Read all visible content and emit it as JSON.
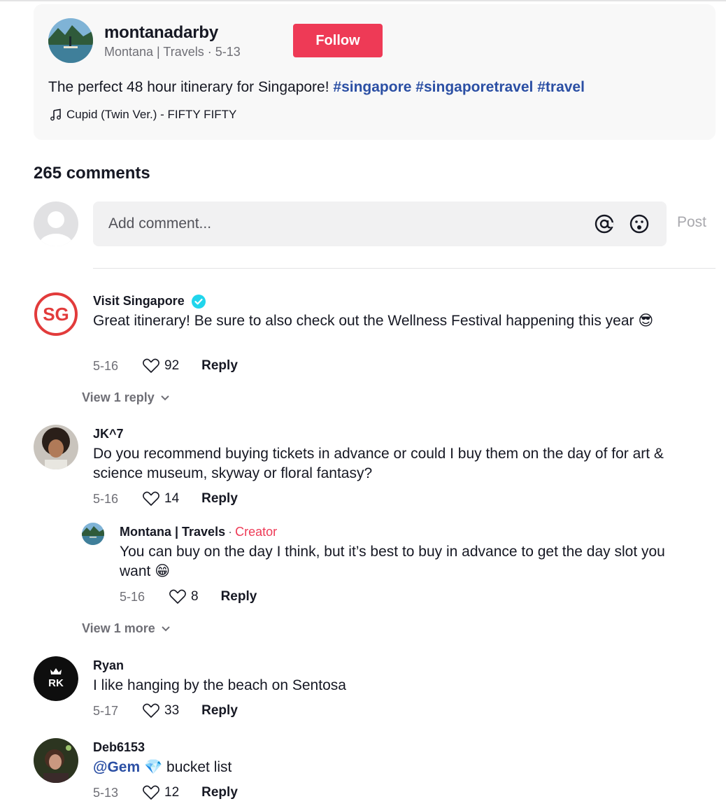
{
  "post": {
    "username": "montanadarby",
    "display_name": "Montana | Travels",
    "date": "5-13",
    "sub_separator": "·",
    "follow_label": "Follow",
    "caption_text": "The perfect 48 hour itinerary for Singapore!",
    "hashtags": [
      "#singapore",
      "#singaporetravel",
      "#travel"
    ],
    "music": "Cupid (Twin Ver.) - FIFTY FIFTY"
  },
  "comments_header": {
    "count_label": "265 comments"
  },
  "composer": {
    "placeholder": "Add comment...",
    "post_label": "Post"
  },
  "comments": [
    {
      "author": "Visit Singapore",
      "verified": true,
      "avatar_text": "SG",
      "text": "Great itinerary! Be sure to also check out the Wellness Festival happening this year",
      "emoji": "😎",
      "date": "5-16",
      "likes": "92",
      "reply_label": "Reply",
      "view_replies": "View 1 reply"
    },
    {
      "author": "JK^7",
      "text": "Do you recommend buying tickets in advance or could I buy them on the day of for art & science museum, skyway or floral fantasy?",
      "date": "5-16",
      "likes": "14",
      "reply_label": "Reply",
      "replies": [
        {
          "author": "Montana | Travels",
          "separator": "·",
          "badge": "Creator",
          "text": "You can buy on the day I think, but it’s best to buy in advance to get the day slot you want",
          "emoji": "😁",
          "date": "5-16",
          "likes": "8",
          "reply_label": "Reply"
        }
      ],
      "view_more": "View 1 more"
    },
    {
      "author": "Ryan",
      "avatar_text": "RK",
      "text": "I like hanging by the beach on Sentosa",
      "date": "5-17",
      "likes": "33",
      "reply_label": "Reply"
    },
    {
      "author": "Deb6153",
      "mention": "@Gem",
      "emoji": "💎",
      "text": "bucket list",
      "date": "5-13",
      "likes": "12",
      "reply_label": "Reply"
    }
  ],
  "colors": {
    "accent": "#ee3a56",
    "hashtag": "#2b4fa4",
    "muted": "#6f6f76",
    "verified": "#20d5ec"
  }
}
